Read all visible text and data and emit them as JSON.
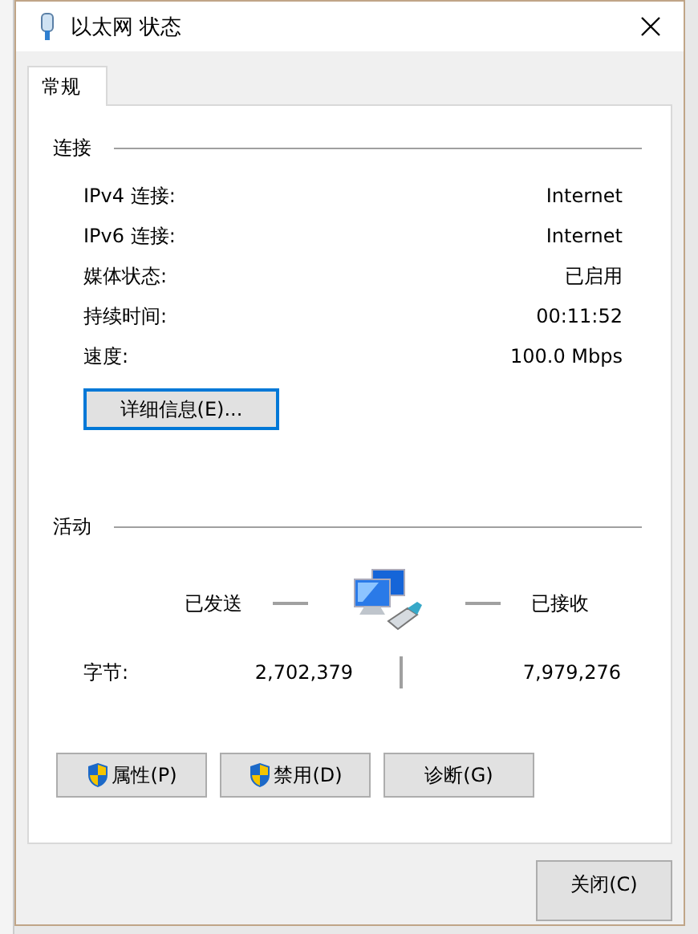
{
  "window": {
    "title": "以太网 状态"
  },
  "tabs": [
    {
      "label": "常规",
      "selected": true
    }
  ],
  "connection": {
    "heading": "连接",
    "rows": [
      {
        "label": "IPv4 连接:",
        "value": "Internet"
      },
      {
        "label": "IPv6 连接:",
        "value": "Internet"
      },
      {
        "label": "媒体状态:",
        "value": "已启用"
      },
      {
        "label": "持续时间:",
        "value": "00:11:52"
      },
      {
        "label": "速度:",
        "value": "100.0 Mbps"
      }
    ],
    "details_button": {
      "label": "详细信息(E)...",
      "focused": true
    }
  },
  "activity": {
    "heading": "活动",
    "sent_label": "已发送",
    "received_label": "已接收",
    "bytes_label": "字节:",
    "bytes_sent": "2,702,379",
    "bytes_received": "7,979,276"
  },
  "buttons": [
    {
      "label": "属性(P)",
      "shield": true
    },
    {
      "label": "禁用(D)",
      "shield": true
    },
    {
      "label": "诊断(G)",
      "shield": false
    }
  ],
  "close_button": "关闭(C)"
}
